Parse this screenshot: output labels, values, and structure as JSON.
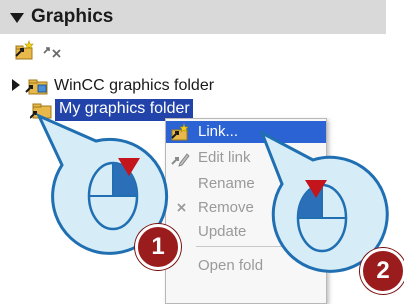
{
  "panel": {
    "title": "Graphics",
    "toolbar": {
      "icons": [
        "link-icon",
        "unlink-icon"
      ]
    }
  },
  "tree": [
    {
      "label": "WinCC graphics folder",
      "icon": "linked-folder-icon",
      "collapsed": true
    },
    {
      "label": "My graphics folder",
      "icon": "folder-icon",
      "selected": true
    }
  ],
  "context_menu": {
    "items": [
      {
        "label": "Link...",
        "highlighted": true,
        "icon": "link-icon"
      },
      {
        "label": "Edit link",
        "disabled": true,
        "icon": "edit-link-icon"
      },
      {
        "label": "Rename",
        "disabled": true
      },
      {
        "label": "Remove",
        "disabled": true,
        "icon": "remove-icon"
      },
      {
        "label": "Update",
        "disabled": true
      },
      {
        "label": "Open fold",
        "disabled": true
      }
    ]
  },
  "callouts": [
    {
      "number": "1",
      "action": "right-click"
    },
    {
      "number": "2",
      "action": "left-click"
    }
  ],
  "colors": {
    "selection": "#2244aa",
    "menu_highlight": "#2b63d4",
    "callout_fill": "#d6ecf7",
    "callout_stroke": "#1f6fb2",
    "click_marker": "#c4151c",
    "badge": "#9a1c1c"
  }
}
